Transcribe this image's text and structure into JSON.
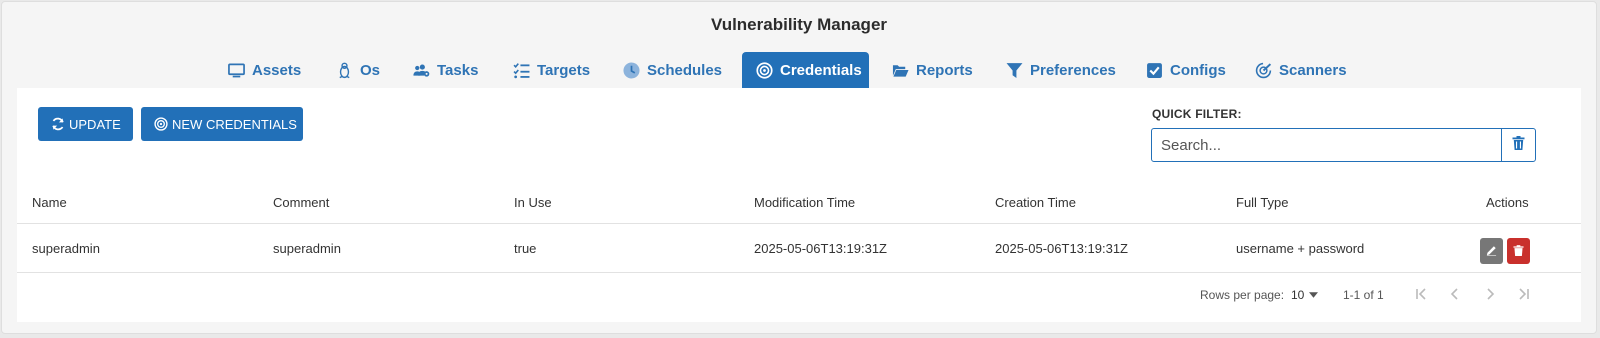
{
  "app": {
    "title": "Vulnerability Manager"
  },
  "tabs": [
    {
      "label": "Assets",
      "icon": "monitor-icon",
      "active": false
    },
    {
      "label": "Os",
      "icon": "linux-penguin-icon",
      "active": false
    },
    {
      "label": "Tasks",
      "icon": "users-gear-icon",
      "active": false
    },
    {
      "label": "Targets",
      "icon": "list-check-icon",
      "active": false
    },
    {
      "label": "Schedules",
      "icon": "clock-icon",
      "active": false
    },
    {
      "label": "Credentials",
      "icon": "bullseye-icon",
      "active": true
    },
    {
      "label": "Reports",
      "icon": "folder-open-icon",
      "active": false
    },
    {
      "label": "Preferences",
      "icon": "filter-icon",
      "active": false
    },
    {
      "label": "Configs",
      "icon": "square-check-icon",
      "active": false
    },
    {
      "label": "Scanners",
      "icon": "radar-icon",
      "active": false
    }
  ],
  "toolbar": {
    "update_label": "UPDATE",
    "new_label": "NEW CREDENTIALS"
  },
  "filter": {
    "label": "QUICK FILTER:",
    "placeholder": "Search...",
    "value": ""
  },
  "table": {
    "columns": [
      "Name",
      "Comment",
      "In Use",
      "Modification Time",
      "Creation Time",
      "Full Type",
      "Actions"
    ],
    "rows": [
      {
        "name": "superadmin",
        "comment": "superadmin",
        "in_use": "true",
        "modification_time": "2025-05-06T13:19:31Z",
        "creation_time": "2025-05-06T13:19:31Z",
        "full_type": "username + password"
      }
    ]
  },
  "pagination": {
    "rows_per_page_label": "Rows per page:",
    "rows_per_page": "10",
    "range": "1-1 of 1"
  },
  "colors": {
    "primary": "#2270b8",
    "edit_button": "#777777",
    "delete_button": "#c9302c"
  }
}
